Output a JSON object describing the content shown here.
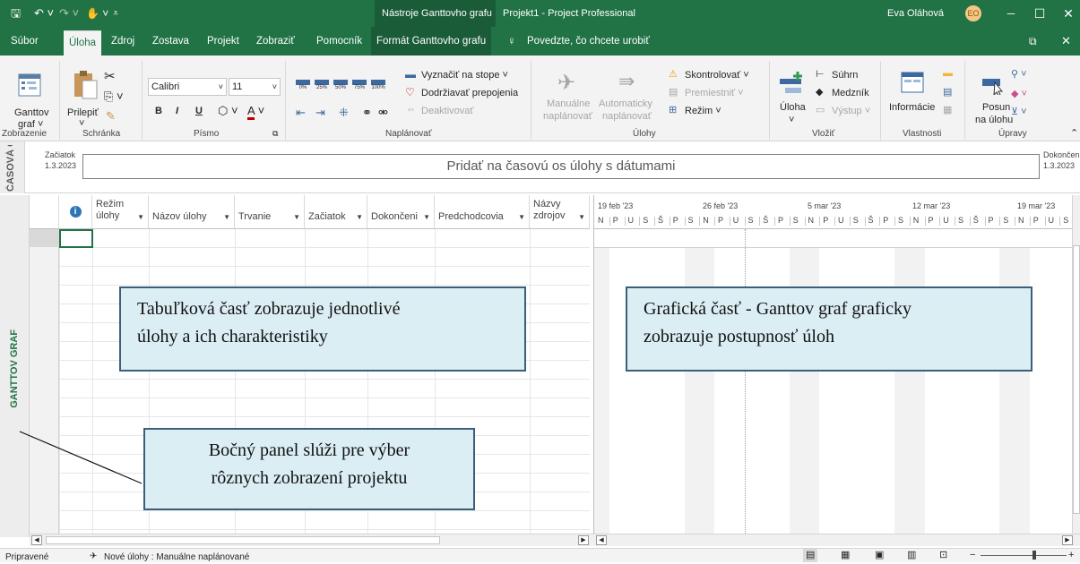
{
  "titlebar": {
    "context_tools": "Nástroje Ganttovho grafu",
    "title": "Projekt1 - Project Professional",
    "user": "Eva Oláhová",
    "initials": "EO",
    "minimize": "─",
    "restore": "☐",
    "close": "✕"
  },
  "tabs": [
    "Súbor",
    "Úloha",
    "Zdroj",
    "Zostava",
    "Projekt",
    "Zobraziť",
    "Pomocník",
    "Formát Ganttovho grafu"
  ],
  "tell_me": "Povedzte, čo chcete urobiť",
  "ribbon": {
    "view": {
      "btn1": "Ganttov",
      "btn2": "graf ˅",
      "label": "Zobrazenie"
    },
    "clipboard": {
      "paste": "Prilepiť",
      "label": "Schránka"
    },
    "font": {
      "name": "Calibri",
      "size": "11",
      "bold": "B",
      "italic": "I",
      "underline": "U",
      "label": "Písmo"
    },
    "schedule": {
      "percents": [
        "0%",
        "25%",
        "50%",
        "75%",
        "100%"
      ],
      "mark": "Vyznačiť na stope",
      "respect": "Dodržiavať prepojenia",
      "inactivate": "Deaktivovať",
      "label": "Naplánovať"
    },
    "tasks": {
      "manual1": "Manuálne",
      "manual2": "naplánovať",
      "auto1": "Automaticky",
      "auto2": "naplánovať",
      "inspect": "Skontrolovať",
      "move": "Premiestniť",
      "mode": "Režim",
      "label": "Úlohy"
    },
    "insert": {
      "task": "Úloha",
      "summary": "Súhrn",
      "milestone": "Medzník",
      "deliverable": "Výstup",
      "label": "Vložiť"
    },
    "properties": {
      "info": "Informácie",
      "label": "Vlastnosti"
    },
    "editing": {
      "scroll1": "Posun",
      "scroll2": "na úlohu",
      "label": "Úpravy"
    }
  },
  "timeline": {
    "side_label": "ČASOVÁ OS",
    "start_label": "Začiatok",
    "start_date": "1.3.2023",
    "end_label": "Dokončenie",
    "end_date": "1.3.2023",
    "placeholder": "Pridať na časovú os úlohy s dátumami"
  },
  "side_panel_label": "GANTTOV GRAF",
  "table": {
    "info_icon": "i",
    "columns": [
      "Režim úlohy",
      "Názov úlohy",
      "Trvanie",
      "Začiatok",
      "Dokončeni",
      "Predchodcovia",
      "Názvy zdrojov"
    ]
  },
  "gantt": {
    "weeks": [
      "19 feb '23",
      "26 feb '23",
      "5 mar '23",
      "12 mar '23",
      "19 mar '23"
    ],
    "days": [
      "N",
      "P",
      "U",
      "S",
      "Š",
      "P",
      "S",
      "N",
      "P",
      "U",
      "S",
      "Š",
      "P",
      "S",
      "N",
      "P",
      "U",
      "S",
      "Š",
      "P",
      "S",
      "N",
      "P",
      "U",
      "S",
      "Š",
      "P",
      "S",
      "N",
      "P",
      "U",
      "S"
    ]
  },
  "callouts": {
    "table": [
      "Tabuľková časť zobrazuje jednotlivé",
      "úlohy a ich charakteristiky"
    ],
    "gantt": [
      "Grafická časť - Ganttov graf graficky",
      "zobrazuje postupnosť úloh"
    ],
    "side": [
      "Bočný panel slúži pre výber",
      "rôznych zobrazení projektu"
    ]
  },
  "status": {
    "ready": "Pripravené",
    "new_tasks": "Nové úlohy : Manuálne naplánované"
  }
}
